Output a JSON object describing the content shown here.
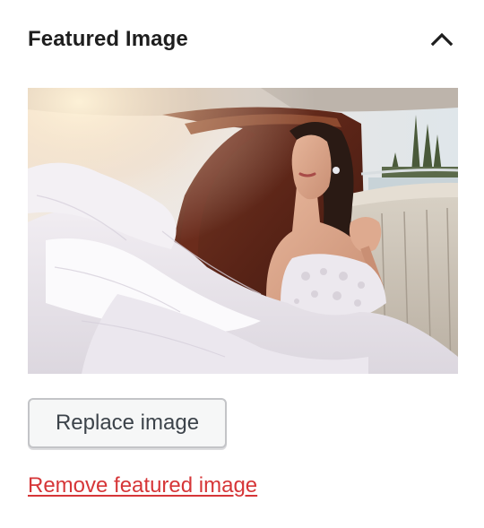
{
  "panel": {
    "title": "Featured Image",
    "toggle_icon": "chevron-up-icon",
    "expanded": true
  },
  "featured_image": {
    "icon": "photo-of-bride-in-boat"
  },
  "actions": {
    "replace_label": "Replace image",
    "remove_label": "Remove featured image"
  },
  "colors": {
    "title_text": "#1e1e1e",
    "button_background": "#f6f7f7",
    "button_border": "#c3c4c7",
    "button_text": "#3c434a",
    "remove_link": "#d63638"
  }
}
